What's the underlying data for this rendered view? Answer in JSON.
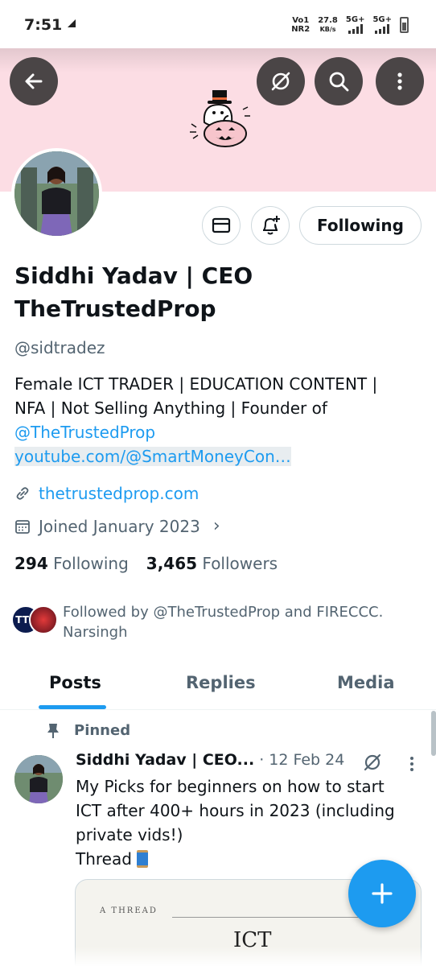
{
  "status_bar": {
    "time": "7:51",
    "carrier_top": "Vo1",
    "carrier_bottom": "NR2",
    "speed_value": "27.8",
    "speed_unit": "KB/s",
    "net1": "5G+",
    "net2": "5G+"
  },
  "header": {
    "back_icon": "arrow-left-icon",
    "grok_icon": "grok-icon",
    "search_icon": "search-icon",
    "more_icon": "more-vertical-icon",
    "banner_art": "halloween-ghost-pumpkin"
  },
  "actions": {
    "message_icon": "mail-icon",
    "notify_icon": "bell-plus-icon",
    "follow_label": "Following"
  },
  "profile": {
    "name": "Siddhi Yadav | CEO TheTrustedProp",
    "handle": "@sidtradez",
    "bio_text": "Female ICT TRADER | EDUCATION CONTENT | NFA | Not Selling Anything | Founder of ",
    "bio_mention": "@TheTrustedProp",
    "bio_link": "youtube.com/@SmartMoneyCon…",
    "website": "thetrustedprop.com",
    "joined": "Joined January 2023",
    "following_count": "294",
    "following_label": "Following",
    "followers_count": "3,465",
    "followers_label": "Followers",
    "followed_by_avatar_text": "TTP",
    "followed_by": "Followed by @TheTrustedProp and FIRECCC. Narsingh"
  },
  "tabs": [
    {
      "label": "Posts",
      "active": true
    },
    {
      "label": "Replies",
      "active": false
    },
    {
      "label": "Media",
      "active": false
    }
  ],
  "post": {
    "pinned_label": "Pinned",
    "author": "Siddhi Yadav | CEO...",
    "date": "· 12 Feb 24",
    "text": "My Picks for beginners on how to start ICT  after 400+ hours in 2023 (including private vids!) Thread",
    "text_line1": "My Picks for beginners on how to start",
    "text_line2": "ICT  after 400+ hours in 2023 (including",
    "text_line3": "private vids!)",
    "text_line4": "Thread",
    "media_kicker": "A THREAD",
    "media_title": "ICT"
  },
  "fab": {
    "icon": "plus-icon"
  },
  "colors": {
    "accent": "#1d9bf0",
    "banner": "#fcdde4",
    "secondary_text": "#536471"
  }
}
